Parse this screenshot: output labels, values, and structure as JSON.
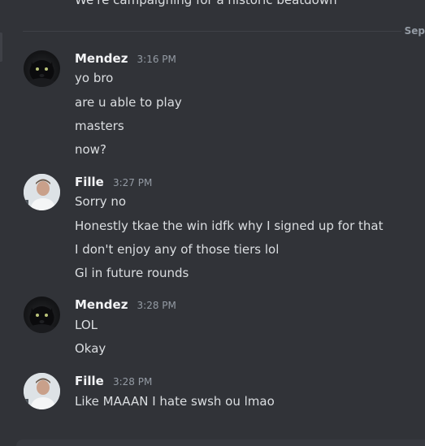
{
  "previous_message": "We're campaigning for a historic beatdown",
  "date_divider": "Sep",
  "messages": [
    {
      "author": "Mendez",
      "time": "3:16 PM",
      "avatar": "panther-avatar",
      "lines": [
        "yo bro",
        "are u able to play",
        "masters",
        "now?"
      ]
    },
    {
      "author": "Fille",
      "time": "3:27 PM",
      "avatar": "person-avatar",
      "lines": [
        "Sorry no",
        "Honestly tkae the win idfk why I signed up for that",
        "I don't enjoy any of those tiers lol",
        "Gl in future rounds"
      ]
    },
    {
      "author": "Mendez",
      "time": "3:28 PM",
      "avatar": "panther-avatar",
      "lines": [
        "LOL",
        "Okay"
      ]
    },
    {
      "author": "Fille",
      "time": "3:28 PM",
      "avatar": "person-avatar",
      "lines": [
        "Like MAAAN I hate swsh ou lmao"
      ]
    }
  ],
  "colors": {
    "background": "#313338",
    "text": "#dbdee1",
    "username": "#f2f3f5",
    "muted": "#949ba4"
  }
}
